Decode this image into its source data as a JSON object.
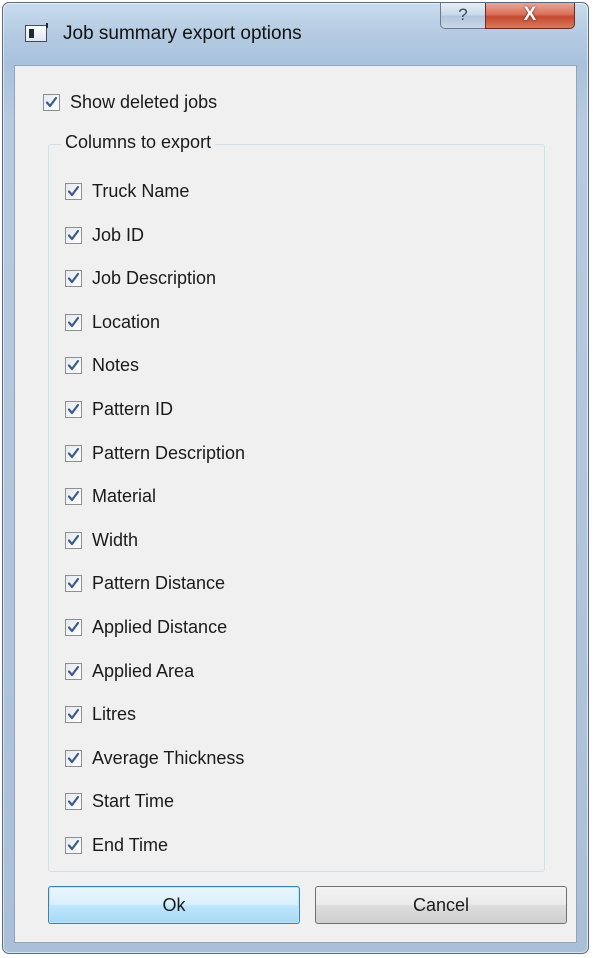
{
  "window": {
    "title": "Job summary export options",
    "help_glyph": "?",
    "close_glyph": "X",
    "icon": "app-window-icon"
  },
  "options": {
    "show_deleted": {
      "label": "Show deleted jobs",
      "checked": true
    }
  },
  "columns_group": {
    "title": "Columns to export",
    "items": [
      {
        "label": "Truck Name",
        "checked": true
      },
      {
        "label": "Job ID",
        "checked": true
      },
      {
        "label": "Job Description",
        "checked": true
      },
      {
        "label": "Location",
        "checked": true
      },
      {
        "label": "Notes",
        "checked": true
      },
      {
        "label": "Pattern ID",
        "checked": true
      },
      {
        "label": "Pattern Description",
        "checked": true
      },
      {
        "label": "Material",
        "checked": true
      },
      {
        "label": "Width",
        "checked": true
      },
      {
        "label": "Pattern Distance",
        "checked": true
      },
      {
        "label": "Applied Distance",
        "checked": true
      },
      {
        "label": "Applied Area",
        "checked": true
      },
      {
        "label": "Litres",
        "checked": true
      },
      {
        "label": "Average Thickness",
        "checked": true
      },
      {
        "label": "Start Time",
        "checked": true
      },
      {
        "label": "End Time",
        "checked": true
      }
    ]
  },
  "buttons": {
    "ok_label": "Ok",
    "cancel_label": "Cancel"
  },
  "colors": {
    "check_mark": "#3d5a8a",
    "frame_accent": "#aac0d8",
    "close_button": "#c54a31"
  }
}
